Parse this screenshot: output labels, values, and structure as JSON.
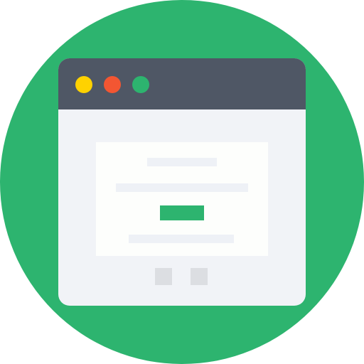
{
  "colors": {
    "circle": "#2db46f",
    "window_body": "#f1f3f7",
    "titlebar": "#4f5765",
    "dot_yellow": "#ffd200",
    "dot_red": "#f35632",
    "dot_green": "#2db46f",
    "card": "#fdfefc",
    "text_bar": "#eef1f6",
    "accent": "#2db46f",
    "pager": "#dcdee2"
  },
  "icons": {
    "window": "browser-window-icon",
    "window_controls": [
      "minimize-dot",
      "close-dot",
      "maximize-dot"
    ],
    "cta": "button-placeholder",
    "pager": [
      "page-square",
      "page-square"
    ]
  }
}
